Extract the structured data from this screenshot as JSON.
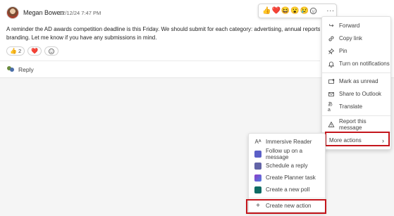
{
  "message": {
    "author": "Megan Bowen",
    "timestamp": "12/12/24 7:47 PM",
    "body_line1": "A reminder the AD awards competition deadline is this Friday. We should submit for each category: advertising, annual reports and integr",
    "body_line2": "branding.  Let me know if you have any submissions in mind.",
    "reactions": [
      {
        "emoji": "👍",
        "count": "2"
      },
      {
        "emoji": "❤️",
        "count": ""
      }
    ],
    "reply_label": "Reply"
  },
  "reaction_bar": {
    "emojis": [
      "👍",
      "❤️",
      "😆",
      "😮",
      "😢"
    ],
    "more_label": "···"
  },
  "main_menu": {
    "items": [
      {
        "label": "Forward",
        "icon": "forward-icon"
      },
      {
        "label": "Copy link",
        "icon": "link-icon"
      },
      {
        "label": "Pin",
        "icon": "pin-icon"
      },
      {
        "label": "Turn on notifications",
        "icon": "bell-icon"
      },
      {
        "label": "Mark as unread",
        "icon": "unread-icon"
      },
      {
        "label": "Share to Outlook",
        "icon": "mail-icon"
      },
      {
        "label": "Translate",
        "icon": "translate-icon"
      },
      {
        "label": "Report this message",
        "icon": "warning-icon"
      },
      {
        "label": "More actions",
        "icon": "chevron-right-icon"
      }
    ]
  },
  "sub_menu": {
    "items": [
      {
        "label": "Immersive Reader",
        "icon": "immersive-reader-icon"
      },
      {
        "label": "Follow up on a message",
        "icon": "follow-up-app-icon"
      },
      {
        "label": "Schedule a reply",
        "icon": "schedule-app-icon"
      },
      {
        "label": "Create Planner task",
        "icon": "planner-app-icon"
      },
      {
        "label": "Create a new poll",
        "icon": "poll-app-icon"
      },
      {
        "label": "Create new action",
        "icon": "plus-icon"
      }
    ]
  },
  "colors": {
    "highlight": "#c4161c",
    "accent": "#5b5fc7"
  }
}
